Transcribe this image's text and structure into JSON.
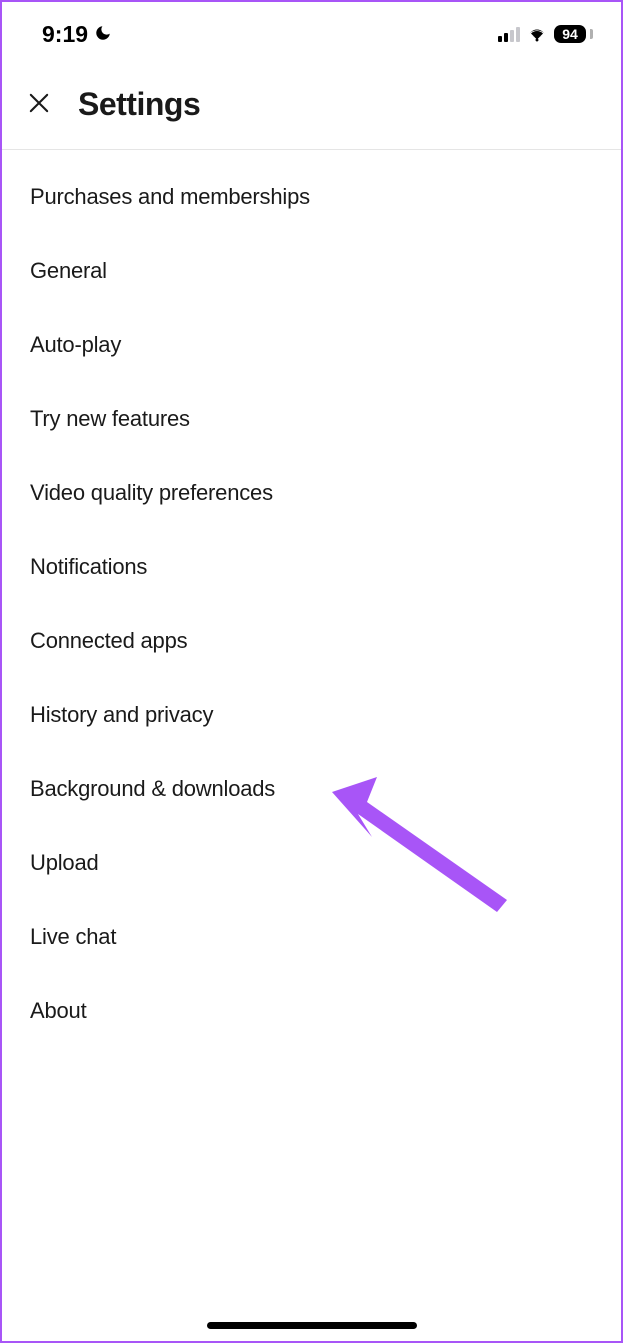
{
  "status": {
    "time": "9:19",
    "battery": "94"
  },
  "header": {
    "title": "Settings"
  },
  "menu": {
    "items": [
      "Purchases and memberships",
      "General",
      "Auto-play",
      "Try new features",
      "Video quality preferences",
      "Notifications",
      "Connected apps",
      "History and privacy",
      "Background & downloads",
      "Upload",
      "Live chat",
      "About"
    ]
  },
  "annotation": {
    "arrow_color": "#a855f7"
  }
}
